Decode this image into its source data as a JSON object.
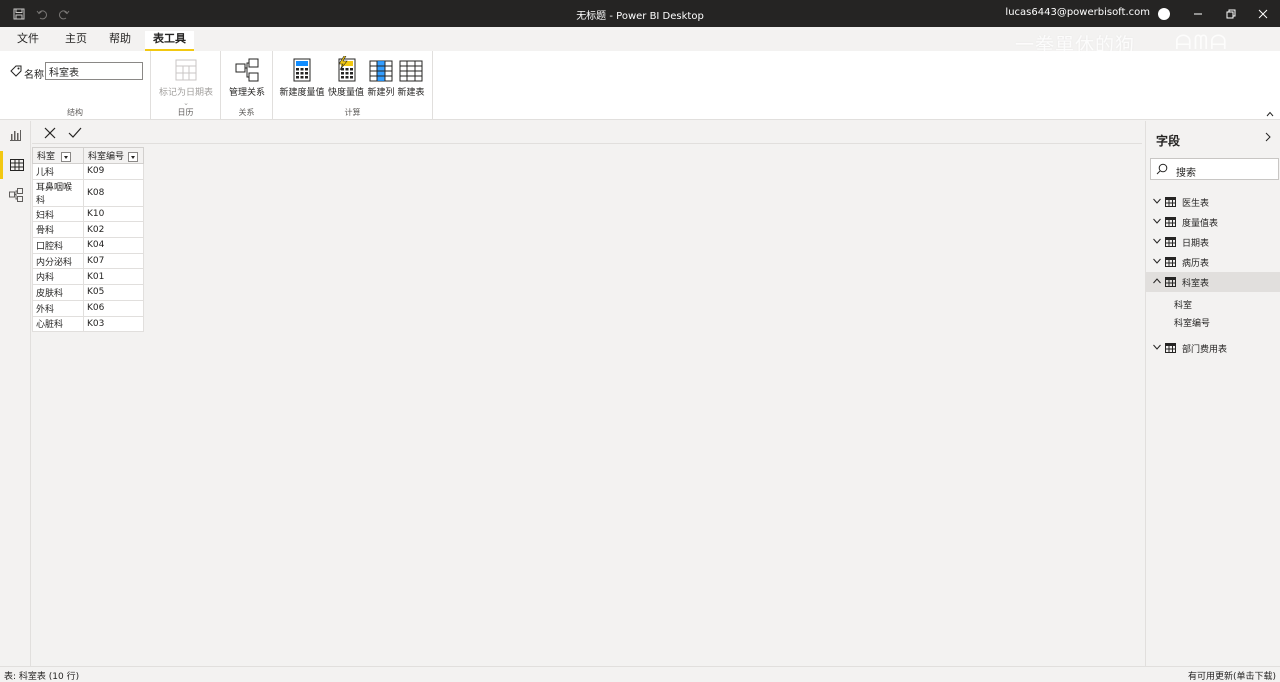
{
  "titlebar": {
    "title": "无标题 - Power BI Desktop",
    "user": "lucas6443@powerbisoft.com"
  },
  "menu": {
    "tabs": [
      {
        "label": "文件"
      },
      {
        "label": "主页"
      },
      {
        "label": "帮助"
      },
      {
        "label": "表工具"
      }
    ],
    "active_tab": "表工具"
  },
  "watermark": {
    "text1": "一拳單休的狗",
    "text2": "ᗩᗰᗩ"
  },
  "ribbon": {
    "name_label": "名称",
    "name_value": "科室表",
    "groups": {
      "structure": "结构",
      "calendar": "日历",
      "relations": "关系",
      "calc": "计算"
    },
    "buttons": {
      "mark_date_table": "标记为日期表",
      "manage_relations": "管理关系",
      "new_measure": "新建度量值",
      "quick_measure": "快度量值",
      "new_column": "新建列",
      "new_table": "新建表"
    }
  },
  "grid": {
    "columns": [
      "科室",
      "科室编号"
    ],
    "rows": [
      [
        "儿科",
        "K09"
      ],
      [
        "耳鼻咽喉科",
        "K08"
      ],
      [
        "妇科",
        "K10"
      ],
      [
        "骨科",
        "K02"
      ],
      [
        "口腔科",
        "K04"
      ],
      [
        "内分泌科",
        "K07"
      ],
      [
        "内科",
        "K01"
      ],
      [
        "皮肤科",
        "K05"
      ],
      [
        "外科",
        "K06"
      ],
      [
        "心脏科",
        "K03"
      ]
    ]
  },
  "fields": {
    "title": "字段",
    "search_placeholder": "搜索",
    "tables": [
      {
        "name": "医生表",
        "expanded": false
      },
      {
        "name": "度量值表",
        "expanded": false
      },
      {
        "name": "日期表",
        "expanded": false
      },
      {
        "name": "病历表",
        "expanded": false
      },
      {
        "name": "科室表",
        "expanded": true,
        "columns": [
          "科室",
          "科室编号"
        ]
      },
      {
        "name": "部门费用表",
        "expanded": false
      }
    ]
  },
  "statusbar": {
    "left": "表: 科室表 (10 行)",
    "right": "有可用更新(单击下载)"
  },
  "colors": {
    "accent": "#f2c811",
    "titlebar": "#252423",
    "pane": "#f3f2f1"
  }
}
